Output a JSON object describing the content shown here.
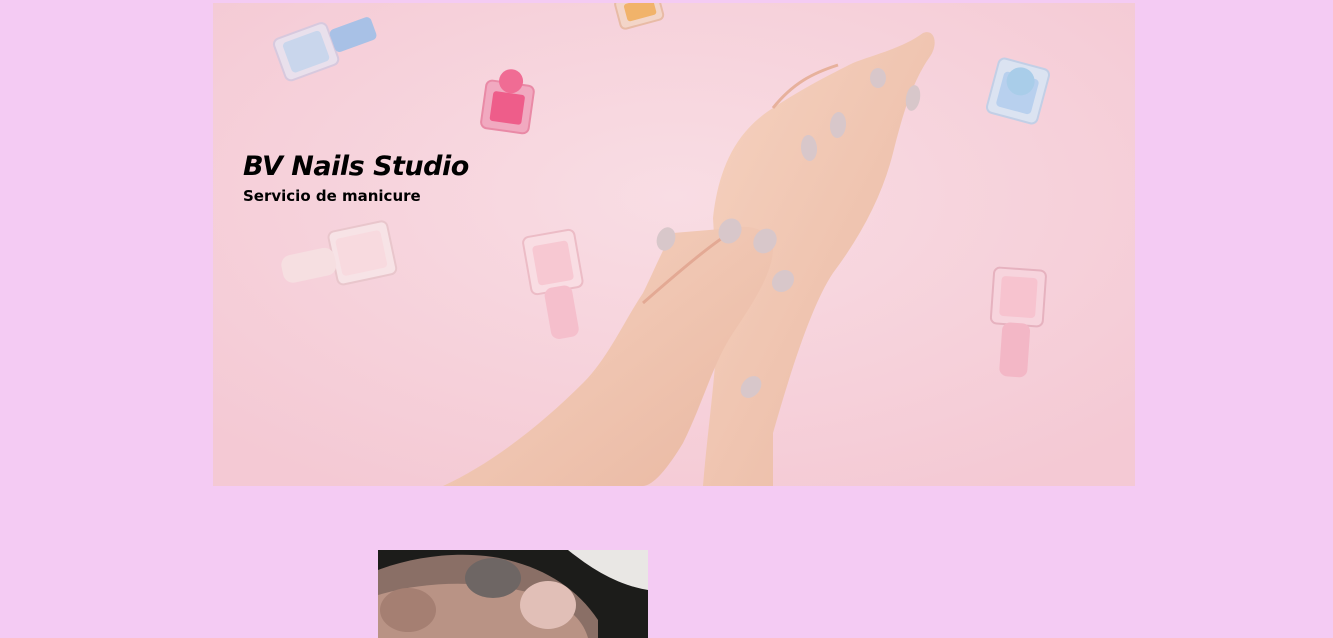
{
  "hero": {
    "title": "BV Nails Studio",
    "subtitle": "Servicio de manicure",
    "image_icon": "hands-with-nail-polish-image"
  },
  "gallery": {
    "image_icon": "manicured-nails-closeup-image"
  },
  "colors": {
    "page_background": "#f4cbf3",
    "hero_background": "#f7d6de",
    "text": "#000000"
  }
}
